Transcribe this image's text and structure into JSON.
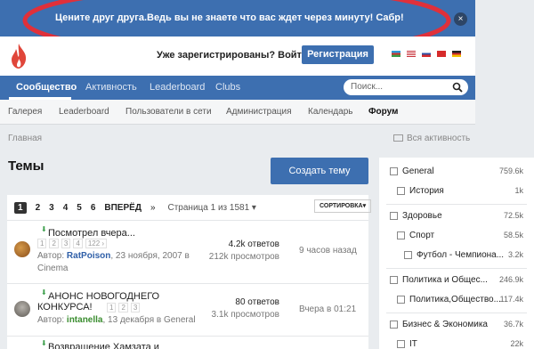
{
  "announcement": {
    "text": "Цените друг друга.Ведь вы не знаете что вас ждет через минуту! Сабр!",
    "close_glyph": "×"
  },
  "header": {
    "signed_question": "Уже зарегистрированы? Войти",
    "chevron": "▾",
    "register_label": "Регистрация",
    "flags": [
      "azerbaijan",
      "usa",
      "russia",
      "turkey",
      "germany"
    ]
  },
  "nav": {
    "items": [
      "Сообщество",
      "Активность",
      "Leaderboard",
      "Clubs"
    ],
    "search_placeholder": "Поиск..."
  },
  "subnav": {
    "items": [
      "Галерея",
      "Leaderboard",
      "Пользователи в сети",
      "Администрация",
      "Календарь",
      "Форум"
    ]
  },
  "breadcrumb": "Главная",
  "activity_link": "Вся активность",
  "page_title": "Темы",
  "create_button": "Создать тему",
  "pager": {
    "pages": [
      "1",
      "2",
      "3",
      "4",
      "5",
      "6"
    ],
    "next": "ВПЕРЁД",
    "arrow": "»",
    "info": "Страница 1 из 1581",
    "info_chev": "▾",
    "sort": "СОРТИРОВКА▾"
  },
  "topics": [
    {
      "title": "Посмотрел вчера...",
      "pages": [
        "1",
        "2",
        "3",
        "4",
        "122 ›"
      ],
      "meta_prefix": "Автор: ",
      "author": "RatPoison",
      "meta_rest": ", 23 ноября, 2007 в",
      "forum": "Cinema",
      "replies": "4.2k ответов",
      "views": "212k просмотров",
      "last": "9 часов назад"
    },
    {
      "title_line1": "АНОНС НОВОГОДНЕГО",
      "title_line2": "КОНКУРСА!",
      "pages": [
        "1",
        "2",
        "3"
      ],
      "meta_prefix": "Автор: ",
      "author": "intanella",
      "meta_rest": ", 13 декабря в General",
      "replies": "80 ответов",
      "views": "3.1k просмотров",
      "last": "Вчера в 01:21"
    },
    {
      "title": "Возвращение Хамзата и"
    }
  ],
  "sidebar": {
    "categories": [
      {
        "name": "General",
        "count": "759.6k"
      },
      {
        "name": "История",
        "count": "1k"
      },
      {
        "name": "Здоровье",
        "count": "72.5k"
      },
      {
        "name": "Спорт",
        "count": "58.5k"
      },
      {
        "name": "Футбол - Чемпиона...",
        "count": "3.2k"
      },
      {
        "name": "Политика и Общес...",
        "count": "246.9k"
      },
      {
        "name": "Политика,Общество...",
        "count": "117.4k"
      },
      {
        "name": "Бизнес & Экономика",
        "count": "36.7k"
      },
      {
        "name": "IT",
        "count": "22k"
      }
    ]
  },
  "colors": {
    "brand_blue": "#3d6fb0",
    "highlight_red": "#e0303a",
    "logo_red": "#e0463a"
  }
}
